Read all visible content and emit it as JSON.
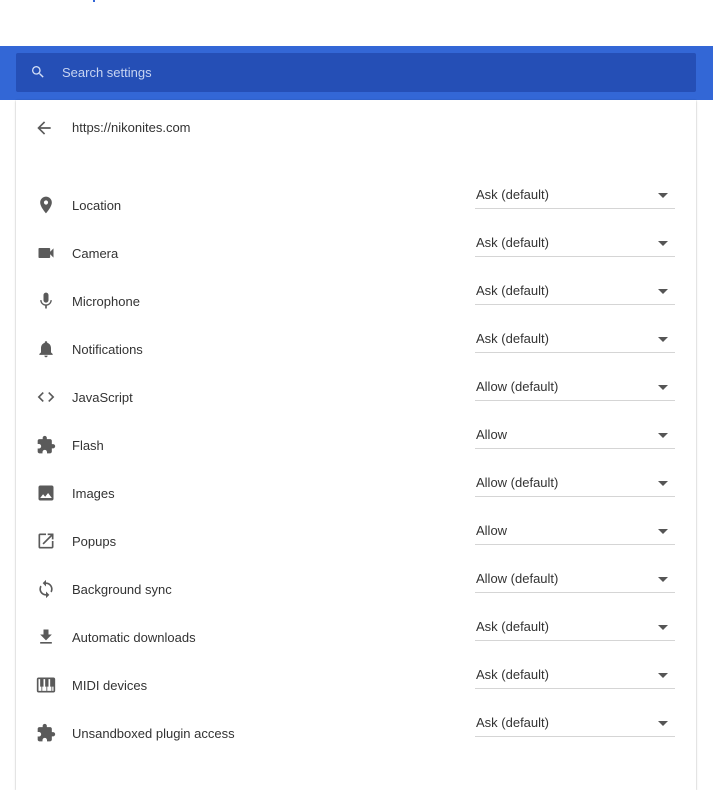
{
  "search": {
    "placeholder": "Search settings"
  },
  "site": {
    "url": "https://nikonites.com"
  },
  "permissions": [
    {
      "label": "Location",
      "value": "Ask (default)",
      "icon": "location-pin-icon"
    },
    {
      "label": "Camera",
      "value": "Ask (default)",
      "icon": "camera-icon"
    },
    {
      "label": "Microphone",
      "value": "Ask (default)",
      "icon": "microphone-icon"
    },
    {
      "label": "Notifications",
      "value": "Ask (default)",
      "icon": "bell-icon"
    },
    {
      "label": "JavaScript",
      "value": "Allow (default)",
      "icon": "code-icon"
    },
    {
      "label": "Flash",
      "value": "Allow",
      "icon": "puzzle-icon"
    },
    {
      "label": "Images",
      "value": "Allow (default)",
      "icon": "image-icon"
    },
    {
      "label": "Popups",
      "value": "Allow",
      "icon": "open-in-new-icon"
    },
    {
      "label": "Background sync",
      "value": "Allow (default)",
      "icon": "sync-icon"
    },
    {
      "label": "Automatic downloads",
      "value": "Ask (default)",
      "icon": "download-icon"
    },
    {
      "label": "MIDI devices",
      "value": "Ask (default)",
      "icon": "piano-icon"
    },
    {
      "label": "Unsandboxed plugin access",
      "value": "Ask (default)",
      "icon": "puzzle-icon"
    }
  ],
  "colors": {
    "header": "#3367d6",
    "search_bg": "#254fb6",
    "icon": "#5a5a5a"
  }
}
